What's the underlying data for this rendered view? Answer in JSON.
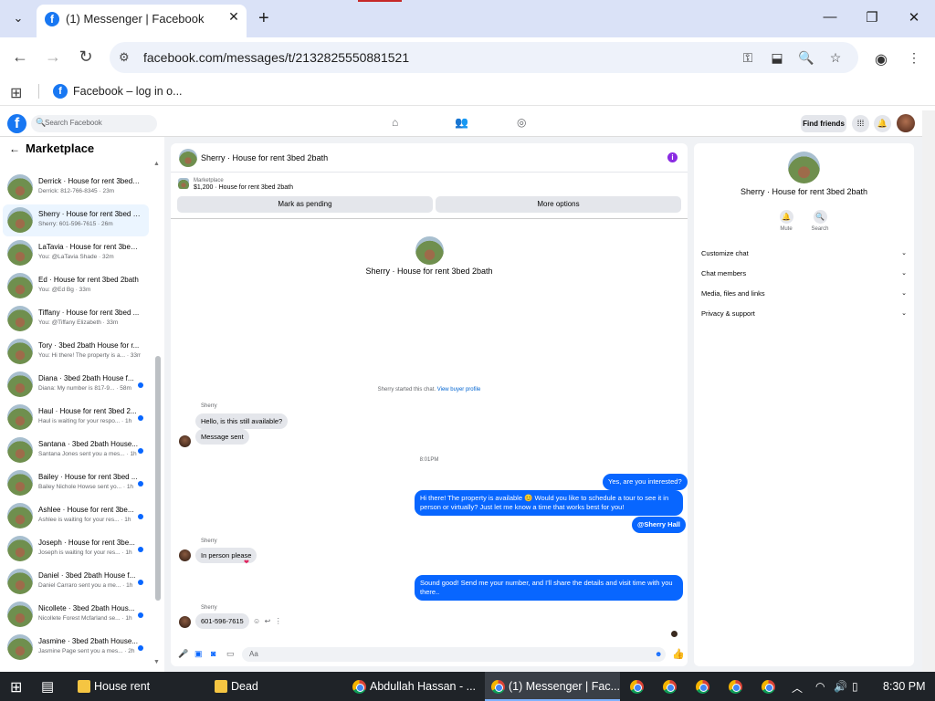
{
  "browser": {
    "tab_title": "(1) Messenger | Facebook",
    "url": "facebook.com/messages/t/2132825550881521",
    "bookmark": "Facebook – log in o..."
  },
  "facebook": {
    "search_placeholder": "Search Facebook",
    "find_friends": "Find friends"
  },
  "sidebar": {
    "title": "Marketplace",
    "conversations": [
      {
        "name": "Derrick · House for rent 3bed ...",
        "preview": "Derrick: 812-766-8345 · 23m",
        "unread": false,
        "selected": false
      },
      {
        "name": "Sherry · House for rent 3bed 2...",
        "preview": "Sherry: 601-596-7615 · 26m",
        "unread": false,
        "selected": true
      },
      {
        "name": "LaTavia · House for rent 3bed ...",
        "preview": "You: @LaTavia Shade · 32m",
        "unread": false,
        "selected": false
      },
      {
        "name": "Ed · House for rent 3bed 2bath",
        "preview": "You: @Ed Bg · 33m",
        "unread": false,
        "selected": false
      },
      {
        "name": "Tiffany · House for rent 3bed ...",
        "preview": "You: @Tiffany Elizabeth · 33m",
        "unread": false,
        "selected": false
      },
      {
        "name": "Tory · 3bed 2bath House for r...",
        "preview": "You: Hi there! The property is a... · 33m",
        "unread": false,
        "selected": false
      },
      {
        "name": "Diana · 3bed 2bath House f...",
        "preview": "Diana: My number is 817-9... · 58m",
        "unread": true,
        "selected": false
      },
      {
        "name": "Haul · House for rent 3bed 2...",
        "preview": "Haul is waiting for your respo... · 1h",
        "unread": true,
        "selected": false
      },
      {
        "name": "Santana · 3bed 2bath House...",
        "preview": "Santana Jones sent you a mes... · 1h",
        "unread": true,
        "selected": false
      },
      {
        "name": "Bailey · House for rent 3bed ...",
        "preview": "Bailey Nichole Howse sent yo... · 1h",
        "unread": true,
        "selected": false
      },
      {
        "name": "Ashlee · House for rent 3be...",
        "preview": "Ashlee is waiting for your res... · 1h",
        "unread": true,
        "selected": false
      },
      {
        "name": "Joseph · House for rent 3be...",
        "preview": "Joseph is waiting for your res... · 1h",
        "unread": true,
        "selected": false
      },
      {
        "name": "Daniel · 3bed 2bath House f...",
        "preview": "Daniel Carraro sent you a me... · 1h",
        "unread": true,
        "selected": false
      },
      {
        "name": "Nicollete · 3bed 2bath Hous...",
        "preview": "Nicollete Forest Mcfarland se... · 1h",
        "unread": true,
        "selected": false
      },
      {
        "name": "Jasmine · 3bed 2bath House...",
        "preview": "Jasmine Page sent you a mes... · 2h",
        "unread": true,
        "selected": false
      }
    ]
  },
  "chat": {
    "title": "Sherry · House for rent 3bed 2bath",
    "listing_source": "Marketplace",
    "listing_summary": "$1,200 · House for rent 3bed 2bath",
    "mark_pending": "Mark as pending",
    "more_options": "More options",
    "intro_name": "Sherry · House for rent 3bed 2bath",
    "started_text": "Sherry started this chat.",
    "view_profile": "View buyer profile",
    "sender_name": "Sherry",
    "msg_1": "Hello, is this still available?",
    "msg_2": "Message sent",
    "timestamp": "8:01PM",
    "msg_3": "Yes, are you interested?",
    "msg_4": "Hi there! The property is available 😊 Would you like to schedule a tour to see it in person or virtually? Just let me know a time that works best for you!",
    "msg_5": "@Sherry Hall",
    "msg_6": "In person please",
    "msg_7": "Sound good! Send me your number, and I'll share the details and visit time with you there..",
    "msg_8": "601-596-7615",
    "composer_placeholder": "Aa"
  },
  "right_panel": {
    "name": "Sherry · House for rent 3bed 2bath",
    "mute": "Mute",
    "search": "Search",
    "sections": [
      "Customize chat",
      "Chat members",
      "Media, files and links",
      "Privacy & support"
    ]
  },
  "taskbar": {
    "items": [
      "House rent",
      "Dead",
      "Abdullah Hassan - ...",
      "(1) Messenger | Fac..."
    ],
    "time": "8:30 PM"
  },
  "colors": {
    "accent": "#0866ff",
    "facebook_blue": "#1877f2"
  }
}
